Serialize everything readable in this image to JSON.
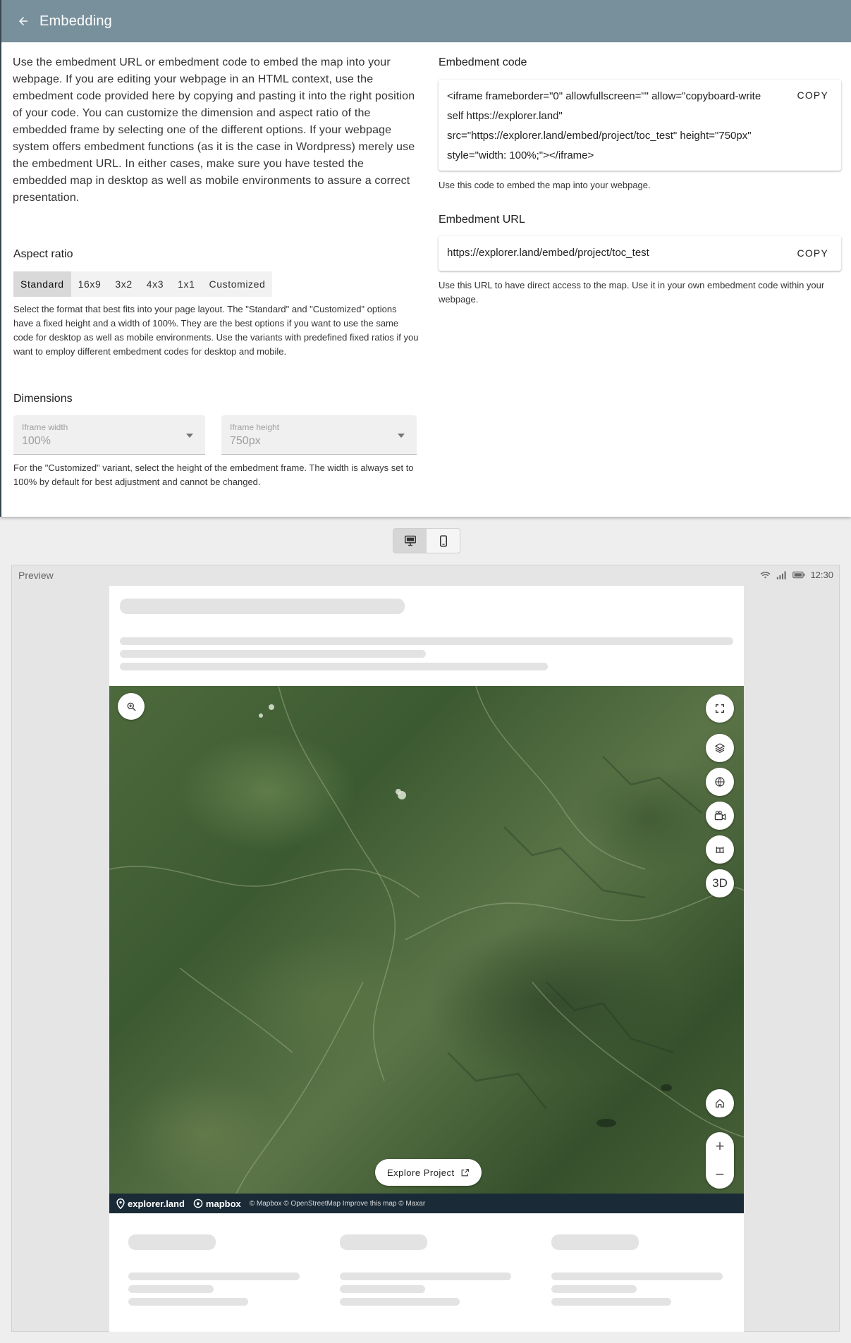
{
  "header": {
    "title": "Embedding"
  },
  "intro": "Use the embedment URL or embedment code to embed the map into your webpage. If you are editing your webpage in an HTML context, use the embedment code provided here by copying and pasting it into the right position of your code. You can customize the dimension and aspect ratio of the embedded frame by selecting one of the different options. If your webpage system offers embedment functions (as it is the case in Wordpress) merely use the embedment URL. In either cases, make sure you have tested the embedded map in desktop as well as mobile environments to assure a correct presentation.",
  "aspect_ratio": {
    "title": "Aspect ratio",
    "options": [
      "Standard",
      "16x9",
      "3x2",
      "4x3",
      "1x1",
      "Customized"
    ],
    "selected": "Standard",
    "hint": "Select the format that best fits into your page layout. The \"Standard\" and \"Customized\" options have a fixed height and a width of 100%. They are the best options if you want to use the same code for desktop as well as mobile environments. Use the variants with predefined fixed ratios if you want to employ different embedment codes for desktop and mobile."
  },
  "dimensions": {
    "title": "Dimensions",
    "width_label": "Iframe width",
    "width_value": "100%",
    "height_label": "Iframe height",
    "height_value": "750px",
    "hint": "For the \"Customized\" variant, select the height of the embedment frame. The width is always set to 100% by default for best adjustment and cannot be changed."
  },
  "embed_code": {
    "title": "Embedment code",
    "code": "<iframe frameborder=\"0\" allowfullscreen=\"\" allow=\"copyboard-write self https://explorer.land\" src=\"https://explorer.land/embed/project/toc_test\" height=\"750px\" style=\"width: 100%;\"></iframe>",
    "copy_label": "COPY",
    "hint": "Use this code to embed the map into your webpage."
  },
  "embed_url": {
    "title": "Embedment URL",
    "url": "https://explorer.land/embed/project/toc_test",
    "copy_label": "COPY",
    "hint": "Use this URL to have direct access to the map. Use it in your own embedment code within your webpage."
  },
  "device_toggle": {
    "options": [
      "desktop-icon",
      "mobile-icon"
    ],
    "selected": "desktop"
  },
  "preview": {
    "label": "Preview",
    "time": "12:30",
    "map": {
      "explore_label": "Explore Project",
      "three_d_label": "3D",
      "zoom_in": "+",
      "zoom_out": "−",
      "brand_explorer": "explorer.land",
      "brand_mapbox": "mapbox",
      "attribution": "© Mapbox © OpenStreetMap Improve this map © Maxar"
    }
  },
  "colors": {
    "appbar": "#78909c",
    "map_footer": "#1a2a36"
  }
}
